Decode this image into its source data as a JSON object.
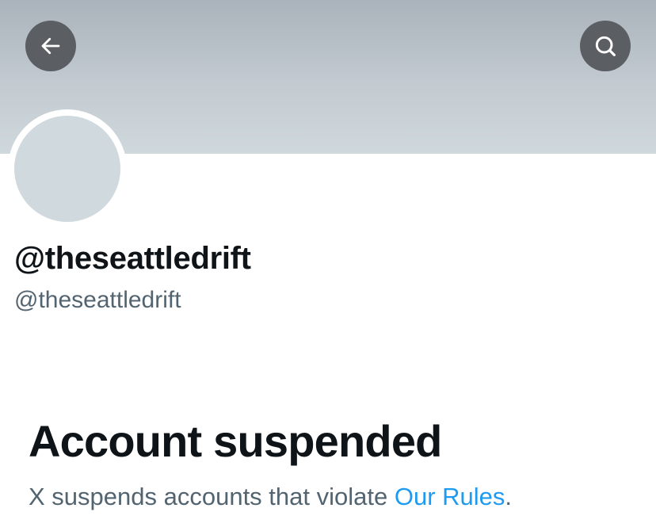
{
  "header": {
    "back_icon": "arrow-left-icon",
    "search_icon": "search-icon"
  },
  "profile": {
    "display_name": "@theseattledrift",
    "handle": "@theseattledrift"
  },
  "suspension": {
    "title": "Account suspended",
    "description_prefix": "X suspends accounts that violate ",
    "rules_link": "Our Rules",
    "description_suffix": "."
  },
  "colors": {
    "banner_top": "#aab3bb",
    "banner_bottom": "#cfd8dd",
    "avatar_placeholder": "#cfd9de",
    "header_button": "#5b5f63",
    "primary_text": "#0f1419",
    "secondary_text": "#536471",
    "link": "#1d9bf0"
  }
}
